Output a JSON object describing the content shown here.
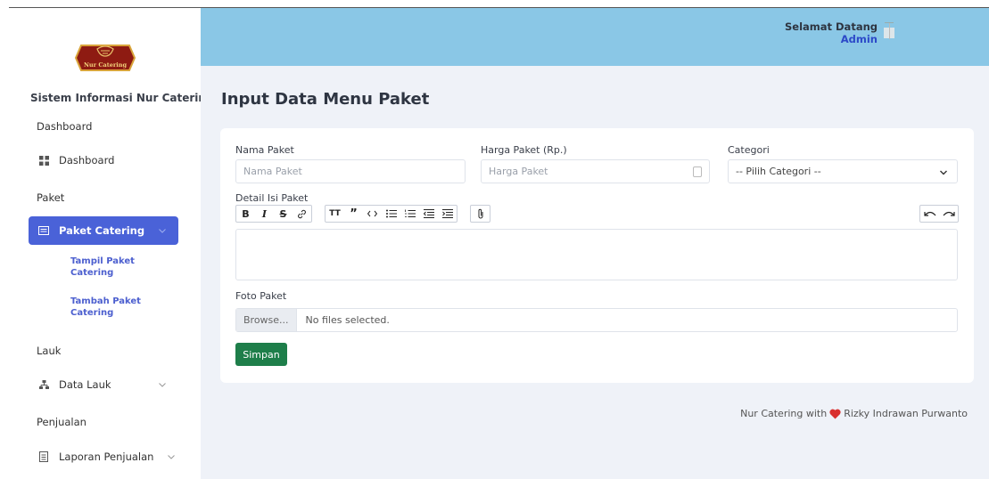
{
  "brand": {
    "logo_text": "Nur Catering",
    "app_title": "Sistem Informasi Nur Catering"
  },
  "header": {
    "greeting": "Selamat Datang",
    "user": "Admin"
  },
  "sidebar": {
    "sections": [
      {
        "label": "Dashboard"
      },
      {
        "label": "Paket"
      },
      {
        "label": "Lauk"
      },
      {
        "label": "Penjualan"
      }
    ],
    "items": [
      {
        "label": "Dashboard",
        "icon": "grid-icon"
      },
      {
        "label": "Paket Catering",
        "icon": "card-icon"
      },
      {
        "label": "Data Lauk",
        "icon": "tree-icon"
      },
      {
        "label": "Laporan Penjualan",
        "icon": "document-icon"
      }
    ],
    "subitems": [
      {
        "label_line1": "Tampil Paket",
        "label_line2": "Catering"
      },
      {
        "label_line1": "Tambah Paket",
        "label_line2": "Catering"
      }
    ]
  },
  "page": {
    "title": "Input Data Menu Paket"
  },
  "form": {
    "name": {
      "label": "Nama Paket",
      "placeholder": "Nama Paket"
    },
    "price": {
      "label": "Harga Paket (Rp.)",
      "placeholder": "Harga Paket"
    },
    "category": {
      "label": "Categori",
      "selected": "-- Pilih Categori --"
    },
    "detail": {
      "label": "Detail Isi Paket"
    },
    "toolbar": {
      "bold": "B",
      "italic": "I",
      "strike": "S",
      "heading": "TT",
      "quote": "”"
    },
    "photo": {
      "label": "Foto Paket",
      "browse": "Browse...",
      "status": "No files selected."
    },
    "submit": "Simpan"
  },
  "footer": {
    "prefix": "Nur Catering with",
    "author": "Rizky Indrawan Purwanto"
  },
  "colors": {
    "accent": "#4a62d8",
    "header": "#8ac7e6",
    "save": "#1e7e4a",
    "heart": "#d9302f"
  }
}
